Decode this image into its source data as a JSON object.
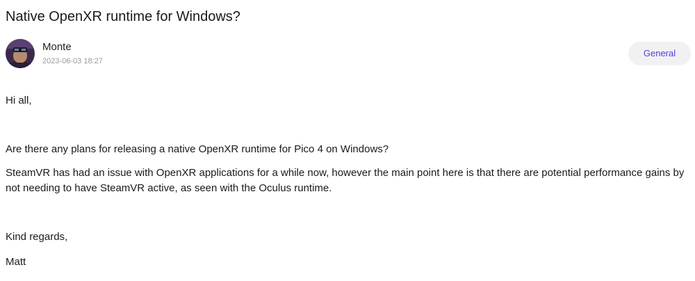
{
  "post": {
    "title": "Native OpenXR runtime for Windows?",
    "author": {
      "name": "Monte",
      "avatar_icon": "user-avatar-icon",
      "date": "2023-06-03 18:27"
    },
    "category": "General",
    "accent_color": "#4b3fd6",
    "body": {
      "greeting": "Hi all,",
      "question": "Are there any plans for releasing a native OpenXR runtime for Pico 4 on Windows?",
      "details": "SteamVR has had an issue with OpenXR applications for a while now, however the main point here is that there are potential performance gains by not needing to have SteamVR active, as seen with the Oculus runtime.",
      "regards": "Kind regards,",
      "signoff": "Matt"
    }
  }
}
